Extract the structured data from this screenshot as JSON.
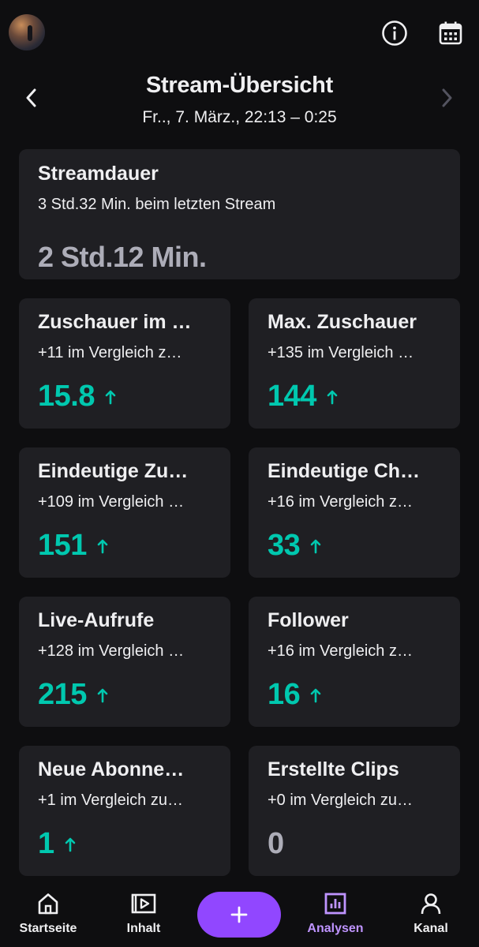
{
  "header": {
    "title": "Stream-Übersicht",
    "subtitle": "Fr.., 7. März., 22:13 – 0:25"
  },
  "stream_duration": {
    "title": "Streamdauer",
    "subtitle": "3 Std.32 Min. beim letzten Stream",
    "value": "2 Std.12 Min."
  },
  "cards": [
    {
      "title": "Zuschauer im …",
      "subtitle": "+11 im Vergleich z…",
      "value": "15.8",
      "trend": "up"
    },
    {
      "title": "Max. Zuschauer",
      "subtitle": "+135 im Vergleich …",
      "value": "144",
      "trend": "up"
    },
    {
      "title": "Eindeutige Zu…",
      "subtitle": "+109 im Vergleich …",
      "value": "151",
      "trend": "up"
    },
    {
      "title": "Eindeutige Ch…",
      "subtitle": "+16 im Vergleich z…",
      "value": "33",
      "trend": "up"
    },
    {
      "title": "Live-Aufrufe",
      "subtitle": "+128 im Vergleich …",
      "value": "215",
      "trend": "up"
    },
    {
      "title": "Follower",
      "subtitle": "+16 im Vergleich z…",
      "value": "16",
      "trend": "up"
    },
    {
      "title": "Neue Abonne…",
      "subtitle": "+1 im Vergleich zu…",
      "value": "1",
      "trend": "up"
    },
    {
      "title": "Erstellte Clips",
      "subtitle": "+0 im Vergleich zu…",
      "value": "0",
      "trend": "none"
    }
  ],
  "bottom_nav": {
    "home": "Startseite",
    "content": "Inhalt",
    "create": "+",
    "analytics": "Analysen",
    "channel": "Kanal"
  },
  "colors": {
    "background": "#0e0e10",
    "card": "#1f1f23",
    "positive": "#00c8af",
    "neutral_value": "#adadb8",
    "accent": "#9147ff",
    "active_nav": "#bf94ff"
  },
  "icons": {
    "info": "info-icon",
    "calendar": "calendar-icon",
    "prev": "chevron-left-icon",
    "next": "chevron-right-icon",
    "trend_up": "arrow-up-icon"
  }
}
